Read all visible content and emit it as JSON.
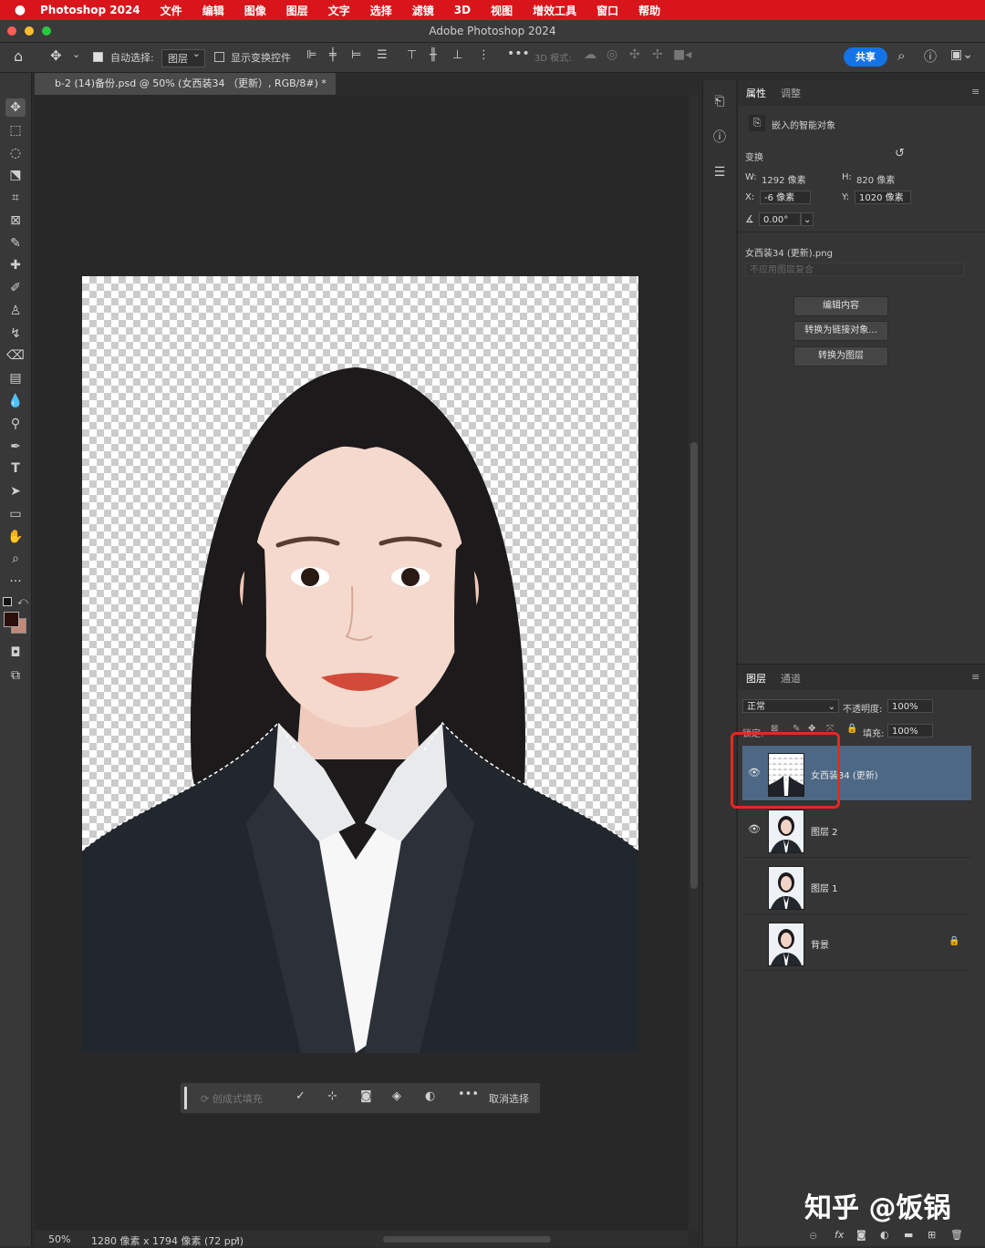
{
  "menubar": {
    "app": "Photoshop 2024",
    "items": [
      "文件",
      "编辑",
      "图像",
      "图层",
      "文字",
      "选择",
      "滤镜",
      "3D",
      "视图",
      "增效工具",
      "窗口",
      "帮助"
    ]
  },
  "window": {
    "title": "Adobe Photoshop 2024"
  },
  "options": {
    "auto_select_label": "自动选择:",
    "auto_select_value": "图层",
    "show_transform_label": "显示变换控件",
    "mode_3d_label": "3D 模式:",
    "share_label": "共享"
  },
  "document": {
    "tab_title": "b-2 (14)备份.psd @ 50% (女西装34 （更新）, RGB/8#) *",
    "zoom": "50%",
    "info": "1280 像素 x 1794 像素 (72 ppi)"
  },
  "context_bar": {
    "generative_fill": "创成式填充",
    "deselect": "取消选择"
  },
  "properties": {
    "tabs": [
      "属性",
      "调整"
    ],
    "object_type": "嵌入的智能对象",
    "transform_label": "变换",
    "w_label": "W:",
    "w_value": "1292 像素",
    "h_label": "H:",
    "h_value": "820 像素",
    "x_label": "X:",
    "x_value": "-6 像素",
    "y_label": "Y:",
    "y_value": "1020 像素",
    "angle_value": "0.00°",
    "file_name": "女西装34 (更新).png",
    "comp_placeholder": "不应用图层复合",
    "buttons": [
      "编辑内容",
      "转换为链接对象...",
      "转换为图层"
    ]
  },
  "layers_panel": {
    "tabs": [
      "图层",
      "通道"
    ],
    "blend_mode": "正常",
    "opacity_label": "不透明度:",
    "opacity_value": "100%",
    "lock_label": "锁定:",
    "fill_label": "填充:",
    "fill_value": "100%",
    "layers": [
      {
        "name": "女西装34 (更新)",
        "visible": true,
        "selected": true
      },
      {
        "name": "图层 2",
        "visible": true,
        "selected": false
      },
      {
        "name": "图层 1",
        "visible": false,
        "selected": false
      },
      {
        "name": "背景",
        "visible": false,
        "selected": false,
        "locked": true
      }
    ]
  },
  "watermark": "知乎 @饭锅",
  "colors": {
    "menubar": "#d8151b",
    "share": "#1473e6",
    "selected_layer": "#4d6885",
    "highlight_box": "#e8271f",
    "foreground": "#2a0f0c",
    "background": "#c08a78"
  }
}
